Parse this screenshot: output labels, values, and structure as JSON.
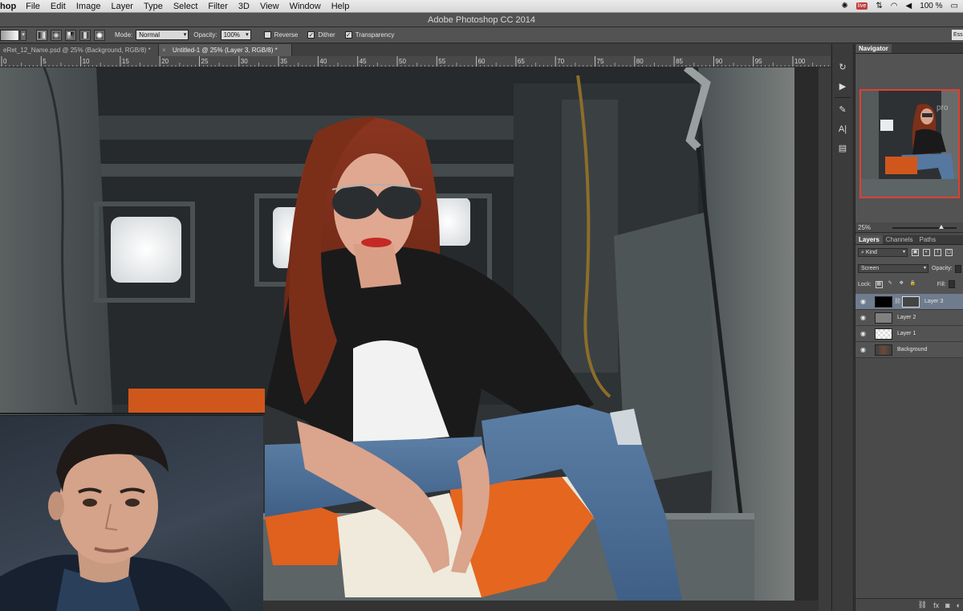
{
  "menubar": {
    "app": "hop",
    "items": [
      "File",
      "Edit",
      "Image",
      "Layer",
      "Type",
      "Select",
      "Filter",
      "3D",
      "View",
      "Window",
      "Help"
    ],
    "status_live": "live",
    "battery": "100 %"
  },
  "window": {
    "title": "Adobe Photoshop CC 2014"
  },
  "options": {
    "mode_label": "Mode:",
    "mode_value": "Normal",
    "opacity_label": "Opacity:",
    "opacity_value": "100%",
    "reverse_label": "Reverse",
    "dither_label": "Dither",
    "transparency_label": "Transparency",
    "reverse_checked": false,
    "dither_checked": true,
    "transparency_checked": true,
    "workspace": "Ess"
  },
  "tabs": [
    {
      "label": "eRet_12_Name.psd @ 25% (Background, RGB/8) *"
    },
    {
      "label": "Untitled-1 @ 25% (Layer 3, RGB/8) *"
    }
  ],
  "ruler": {
    "ticks": [
      "0",
      "5",
      "10",
      "15",
      "20",
      "25",
      "30",
      "35",
      "40",
      "45",
      "50",
      "55",
      "60",
      "65",
      "70",
      "75",
      "80",
      "85",
      "90",
      "95",
      "100"
    ]
  },
  "navigator": {
    "tab": "Navigator",
    "zoom": "25%"
  },
  "layers_panel": {
    "tabs": [
      "Layers",
      "Channels",
      "Paths"
    ],
    "kind_label": "Kind",
    "blend_mode": "Screen",
    "opacity_label": "Opacity:",
    "lock_label": "Lock:",
    "fill_label": "Fill:",
    "layers": [
      {
        "name": "Layer 3",
        "selected": true
      },
      {
        "name": "Layer 2",
        "selected": false
      },
      {
        "name": "Layer 1",
        "selected": false
      },
      {
        "name": "Background",
        "selected": false
      }
    ]
  },
  "colors": {
    "accent_red": "#e04030",
    "selected_layer": "#6f7c8e",
    "panel_bg": "#535353"
  }
}
